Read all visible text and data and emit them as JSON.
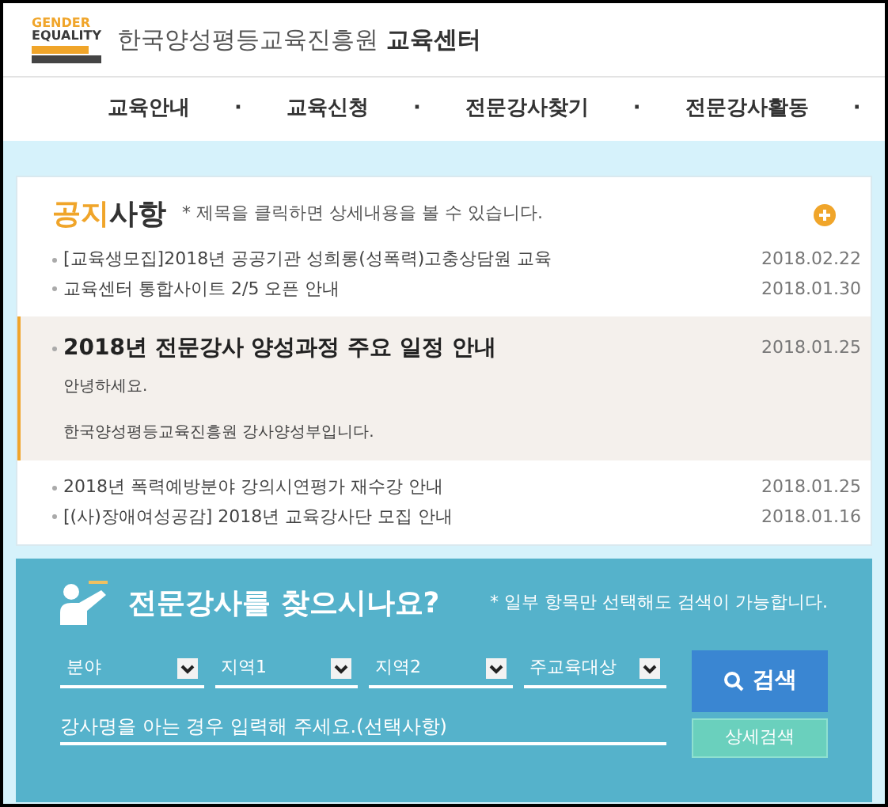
{
  "logo": {
    "line1": "GENDER",
    "line2": "EQUALITY"
  },
  "site_title": {
    "org": "한국양성평등교육진흥원",
    "center": "교육센터"
  },
  "nav": [
    {
      "label": "교육안내",
      "separator": "·"
    },
    {
      "label": "교육신청",
      "separator": "·"
    },
    {
      "label": "전문강사찾기",
      "separator": "·"
    },
    {
      "label": "전문강사활동",
      "separator": "·"
    }
  ],
  "notices": {
    "title_accent": "공지",
    "title_rest": "사항",
    "hint": "* 제목을 클릭하면 상세내용을 볼 수 있습니다.",
    "items": [
      {
        "title": "[교육생모집]2018년 공공기관 성희롱(성폭력)고충상담원 교육",
        "date": "2018.02.22",
        "expanded": false
      },
      {
        "title": "교육센터 통합사이트 2/5 오픈 안내",
        "date": "2018.01.30",
        "expanded": false
      },
      {
        "title": "2018년 전문강사 양성과정 주요 일정 안내",
        "date": "2018.01.25",
        "expanded": true,
        "body": [
          "안녕하세요.",
          "한국양성평등교육진흥원 강사양성부입니다."
        ]
      },
      {
        "title": "2018년 폭력예방분야 강의시연평가 재수강 안내",
        "date": "2018.01.25",
        "expanded": false
      },
      {
        "title": "[(사)장애여성공감] 2018년 교육강사단 모집 안내",
        "date": "2018.01.16",
        "expanded": false
      }
    ]
  },
  "search": {
    "title": "전문강사를 찾으시나요?",
    "note": "* 일부 항목만 선택해도 검색이 가능합니다.",
    "selects": [
      "분야",
      "지역1",
      "지역2",
      "주교육대상"
    ],
    "name_field": {
      "placeholder": "강사명을 아는 경우 입력해 주세요.(선택사항)"
    },
    "search_button": "검색",
    "detail_button": "상세검색"
  }
}
